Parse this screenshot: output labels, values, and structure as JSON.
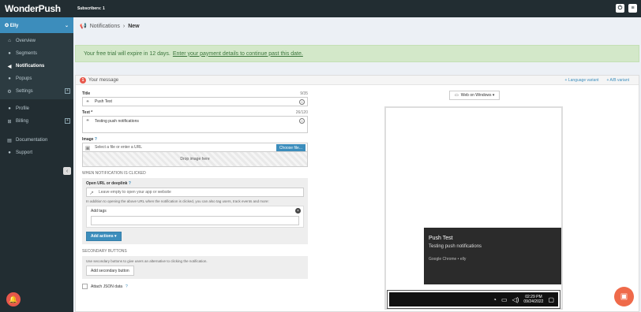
{
  "topbar": {
    "logo": "WonderPush",
    "subscribers": "Subscribers: 1"
  },
  "sidebar": {
    "account": "Elly",
    "items": [
      {
        "label": "Overview",
        "icon": "home-icon"
      },
      {
        "label": "Segments",
        "icon": "users-icon"
      },
      {
        "label": "Notifications",
        "icon": "megaphone-icon"
      },
      {
        "label": "Popups",
        "icon": "comment-icon"
      },
      {
        "label": "Settings",
        "icon": "gear-icon"
      },
      {
        "label": "Profile",
        "icon": "user-icon"
      },
      {
        "label": "Billing",
        "icon": "cart-icon"
      },
      {
        "label": "Documentation",
        "icon": "book-icon"
      },
      {
        "label": "Support",
        "icon": "comments-icon"
      }
    ]
  },
  "breadcrumb": {
    "section": "Notifications",
    "current": "New"
  },
  "alert": {
    "text": "Your free trial will expire in 12 days.",
    "link": "Enter your payment details to continue past this date."
  },
  "panel": {
    "step": "1",
    "title": "Your message",
    "language_variant": "+ Language variant",
    "ab_variant": "+ A/B variant"
  },
  "form": {
    "title_label": "Title",
    "title_count": "9/35",
    "title_value": "Push Test",
    "text_label": "Text *",
    "text_count": "26/120",
    "text_value": "Testing push notifications",
    "image_label": "Image",
    "image_placeholder": "Select a file or enter a URL",
    "choose_file": "Choose file...",
    "drop_image": "Drop image here",
    "when_clicked": "WHEN NOTIFICATION IS CLICKED",
    "open_url_label": "Open URL or deeplink",
    "open_url_placeholder": "Leave empty to open your app or website",
    "url_help": "In addition to opening the above URL when the notification is clicked, you can also tag users, track events and more:",
    "add_tags": "Add tags",
    "add_actions": "Add actions ▾",
    "secondary_title": "SECONDARY BUTTONS",
    "secondary_help": "Use secondary buttons to give users an alternative to clicking the notification.",
    "add_secondary": "Add secondary button",
    "attach_json": "Attach JSON data"
  },
  "preview": {
    "device": "Web on Windows ▾",
    "notif_title": "Push Test",
    "notif_body": "Testing push notifications",
    "notif_source": "Google Chrome • elly",
    "time": "02:29 PM",
    "date": "09/24/2022"
  }
}
